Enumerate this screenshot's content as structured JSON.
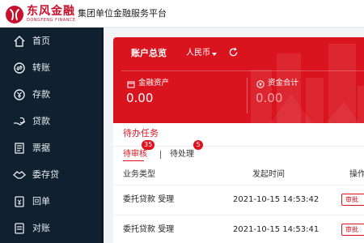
{
  "header": {
    "brand_cn": "东风金融",
    "brand_en": "DONGFENG FINANCE",
    "platform_title": "集团单位金融服务平台"
  },
  "sidebar": {
    "items": [
      {
        "label": "首页",
        "icon": "home-icon"
      },
      {
        "label": "转账",
        "icon": "transfer-icon"
      },
      {
        "label": "存款",
        "icon": "deposit-icon"
      },
      {
        "label": "贷款",
        "icon": "loan-icon"
      },
      {
        "label": "票据",
        "icon": "bill-icon"
      },
      {
        "label": "委存贷",
        "icon": "entrust-icon"
      },
      {
        "label": "回单",
        "icon": "receipt-icon"
      },
      {
        "label": "对账",
        "icon": "reconcile-icon"
      }
    ]
  },
  "summary": {
    "title": "账户总览",
    "currency": "人民币",
    "financial_assets_label": "金融资产",
    "financial_assets_value": "0.00",
    "fund_total_label": "资金合计",
    "fund_total_value": "0.00"
  },
  "tasks": {
    "title": "待办任务",
    "tab_review_label": "待审核",
    "tab_review_count": "35",
    "tab_pending_label": "待处理",
    "tab_pending_count": "5",
    "columns": {
      "type": "业务类型",
      "time": "发起时间",
      "action": "操作"
    },
    "rows": [
      {
        "type": "委托贷款 受理",
        "time": "2021-10-15 14:53:42",
        "action": "审批"
      },
      {
        "type": "委托贷款 受理",
        "time": "2021-10-15 14:53:41",
        "action": "审批"
      }
    ]
  },
  "colors": {
    "brand_red": "#d9141f",
    "sidebar_bg": "#10202e"
  }
}
